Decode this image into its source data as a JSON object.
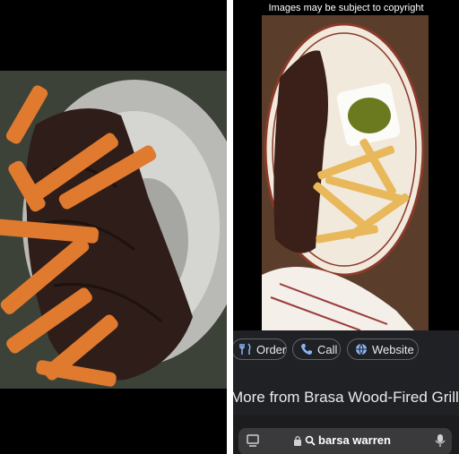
{
  "header": {
    "copyright_note": "Images may be subject to copyright"
  },
  "actions": {
    "order_label": "Order",
    "call_label": "Call",
    "website_label": "Website"
  },
  "more": {
    "title": "More from Brasa Wood-Fired Grill"
  },
  "browser": {
    "url_text": "barsa warren"
  },
  "icons": [
    "utensils-icon",
    "phone-icon",
    "globe-icon",
    "tabs-icon",
    "lock-icon",
    "search-icon",
    "microphone-icon"
  ],
  "colors": {
    "chip_text": "#e8eaed",
    "icon_blue": "#8ab4f8",
    "panel_bg": "#202124"
  }
}
